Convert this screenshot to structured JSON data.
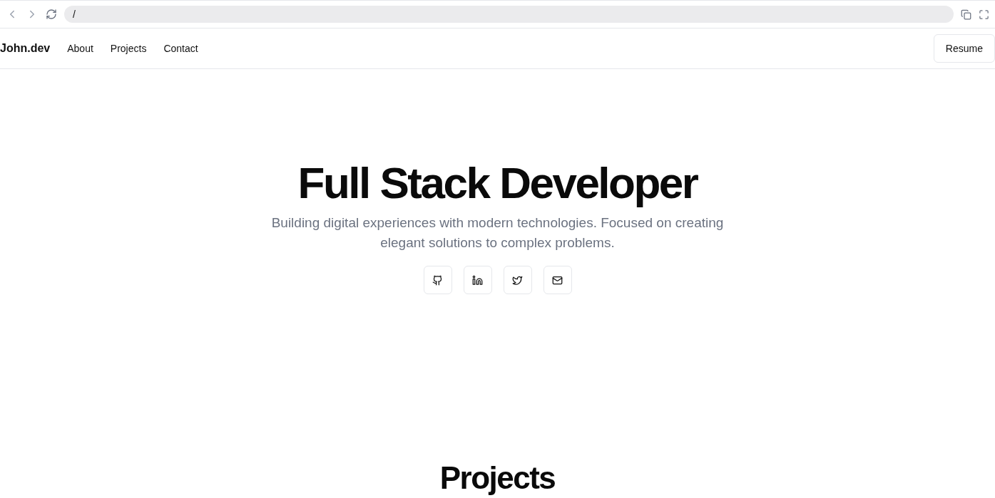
{
  "browser": {
    "url": "/"
  },
  "nav": {
    "logo": "John.dev",
    "links": [
      "About",
      "Projects",
      "Contact"
    ],
    "button": "Resume"
  },
  "hero": {
    "title": "Full Stack Developer",
    "subtitle": "Building digital experiences with modern technologies. Focused on creating elegant solutions to complex problems.",
    "socials": [
      {
        "kind": "github"
      },
      {
        "kind": "linkedin"
      },
      {
        "kind": "twitter"
      },
      {
        "kind": "mail"
      }
    ]
  },
  "projects": {
    "heading": "Projects"
  }
}
